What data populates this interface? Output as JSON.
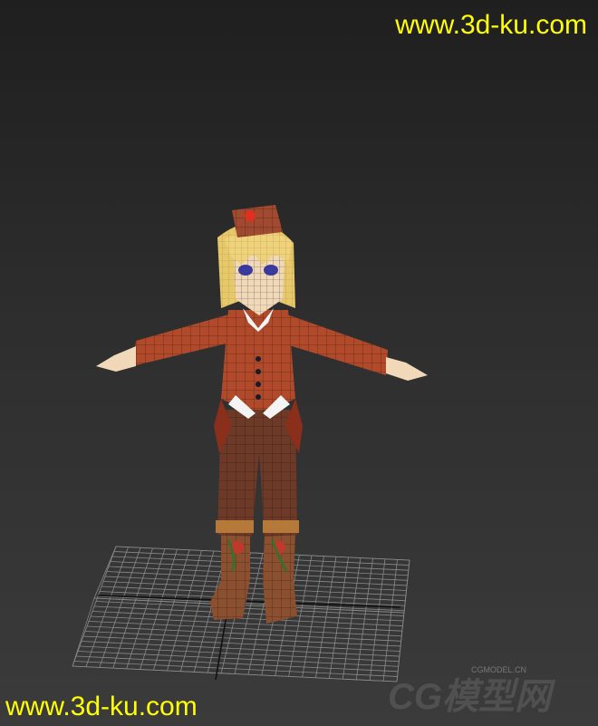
{
  "watermarks": {
    "top": "www.3d-ku.com",
    "bottom": "www.3d-ku.com",
    "logo_text": "CG模型网",
    "logo_url": "CGMODEL.CN"
  },
  "colors": {
    "watermark": "#ffff00",
    "grid": "#8a8a8a",
    "jacket": "#b04a2a",
    "trousers": "#6e3a28",
    "hair": "#e8c96a",
    "skin": "#f0d8b8",
    "boots": "#8a5030"
  }
}
